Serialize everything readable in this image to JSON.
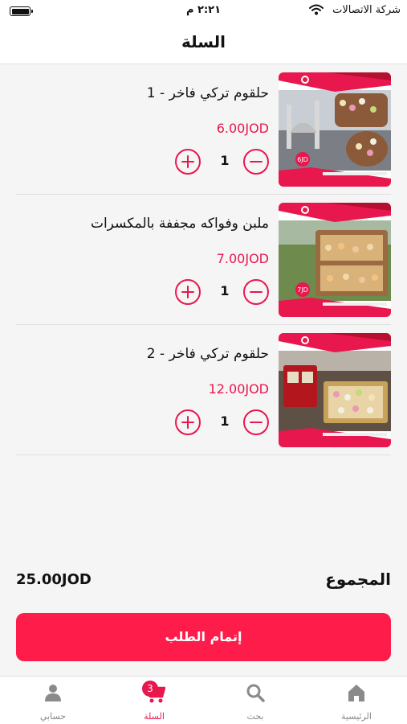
{
  "status_bar": {
    "carrier": "شركة الاتصالات",
    "time": "٢:٢١ م"
  },
  "header": {
    "title": "السلة"
  },
  "cart": {
    "items": [
      {
        "name": "حلقوم تركي فاخر - 1",
        "price": "6.00JOD",
        "quantity": "1",
        "thumb_price": "6JD",
        "thumb_phone": "0777777105",
        "thumb_address": "Jordan - Amman - Wadi Al Sir"
      },
      {
        "name": "ملبن وفواكه مجففة بالمكسرات",
        "price": "7.00JOD",
        "quantity": "1",
        "thumb_price": "7JD",
        "thumb_phone": "0777777105",
        "thumb_address": "Jordan - Amman - Wadi Al Sir"
      },
      {
        "name": "حلقوم تركي فاخر - 2",
        "price": "12.00JOD",
        "quantity": "1",
        "thumb_price": "",
        "thumb_phone": "0777777105",
        "thumb_address": "Jordan - Amman - Wadi Al Sir"
      }
    ]
  },
  "summary": {
    "total_label": "المجموع",
    "total_value": "25.00JOD"
  },
  "checkout": {
    "label": "إتمام الطلب"
  },
  "tab_bar": {
    "tabs": [
      {
        "label": "الرئيسية",
        "icon": "home-icon"
      },
      {
        "label": "بحث",
        "icon": "search-icon"
      },
      {
        "label": "السلة",
        "icon": "cart-icon",
        "badge": "3"
      },
      {
        "label": "حسابي",
        "icon": "user-icon"
      }
    ]
  },
  "colors": {
    "accent": "#e8174d",
    "button": "#fd1c4a",
    "background": "#f5f5f5"
  }
}
